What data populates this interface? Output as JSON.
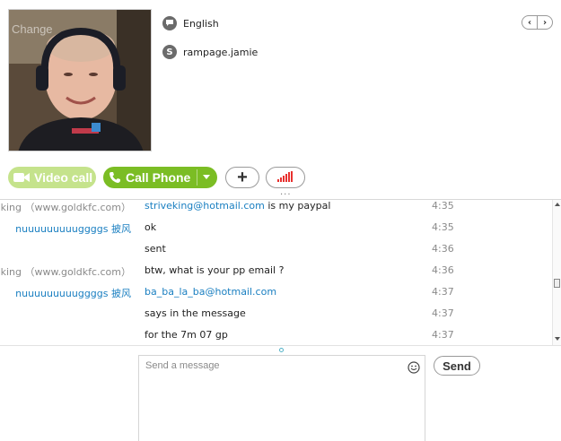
{
  "profile": {
    "avatar_overlay_text": "Change",
    "language": "English",
    "skype_name": "rampage.jamie"
  },
  "actions": {
    "video_call_label": "Video call",
    "call_phone_label": "Call Phone",
    "add_label": "+"
  },
  "messages": [
    {
      "sender": "king （www.goldkfc.com）",
      "sender_type": "them",
      "parts": [
        {
          "text": "striveking@hotmail.com",
          "link": true
        },
        {
          "text": " is my paypal",
          "link": false
        }
      ],
      "time": "4:35"
    },
    {
      "sender": "nuuuuuuuuuggggs 披风",
      "sender_type": "me",
      "parts": [
        {
          "text": "ok",
          "link": false
        }
      ],
      "time": "4:35"
    },
    {
      "sender": "",
      "sender_type": "me",
      "parts": [
        {
          "text": "sent",
          "link": false
        }
      ],
      "time": "4:36"
    },
    {
      "sender": "king （www.goldkfc.com）",
      "sender_type": "them",
      "parts": [
        {
          "text": "btw, what is your pp email ?",
          "link": false
        }
      ],
      "time": "4:36"
    },
    {
      "sender": "nuuuuuuuuuggggs 披风",
      "sender_type": "me",
      "parts": [
        {
          "text": "ba_ba_la_ba@hotmail.com",
          "link": true
        }
      ],
      "time": "4:37"
    },
    {
      "sender": "",
      "sender_type": "me",
      "parts": [
        {
          "text": "says in the message",
          "link": false
        }
      ],
      "time": "4:37"
    },
    {
      "sender": "",
      "sender_type": "me",
      "parts": [
        {
          "text": "for the 7m 07 gp",
          "link": false
        }
      ],
      "time": "4:37"
    }
  ],
  "compose": {
    "placeholder": "Send a message",
    "send_label": "Send"
  },
  "colors": {
    "call_green": "#7bbd24",
    "video_green_disabled": "#c5e38c",
    "link_blue": "#1a7fc1"
  },
  "icons": {
    "language": "speech-bubble-icon",
    "skype": "skype-icon",
    "video": "video-camera-icon",
    "phone": "phone-icon",
    "signal": "signal-bars-icon",
    "emoji": "smiley-icon"
  }
}
